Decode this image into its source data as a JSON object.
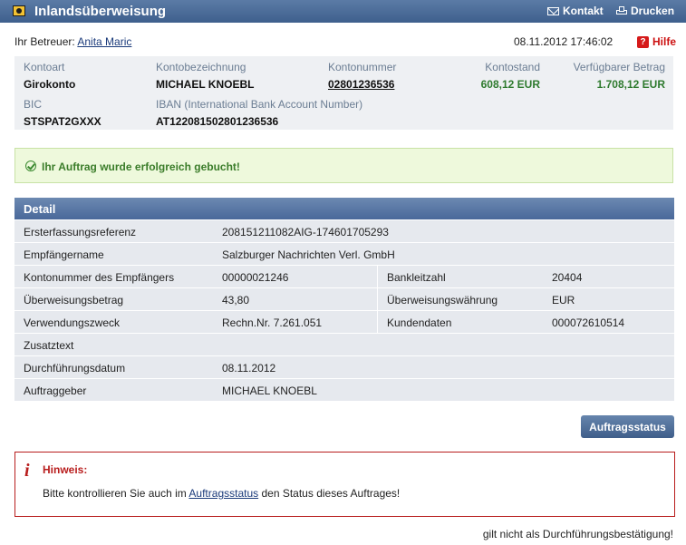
{
  "header": {
    "title": "Inlandsüberweisung",
    "kontakt_label": "Kontakt",
    "drucken_label": "Drucken"
  },
  "betreuer": {
    "label": "Ihr Betreuer:",
    "name": "Anita Maric"
  },
  "datetime": "08.11.2012 17:46:02",
  "hilfe_label": "Hilfe",
  "account": {
    "kontoart_label": "Kontoart",
    "kontoart": "Girokonto",
    "kontobezeichnung_label": "Kontobezeichnung",
    "kontobezeichnung": "MICHAEL KNOEBL",
    "kontonummer_label": "Kontonummer",
    "kontonummer": "02801236536",
    "kontostand_label": "Kontostand",
    "kontostand": "608,12 EUR",
    "verfuegbar_label": "Verfügbarer Betrag",
    "verfuegbar": "1.708,12 EUR",
    "bic_label": "BIC",
    "bic": "STSPAT2GXXX",
    "iban_label": "IBAN (International Bank Account Number)",
    "iban": "AT122081502801236536"
  },
  "success_message": "Ihr Auftrag wurde erfolgreich gebucht!",
  "detail": {
    "title": "Detail",
    "ersterfassung_label": "Ersterfassungsreferenz",
    "ersterfassung": "208151211082AIG-174601705293",
    "empfaengername_label": "Empfängername",
    "empfaengername": "Salzburger Nachrichten Verl. GmbH",
    "kontonummer_empf_label": "Kontonummer des Empfängers",
    "kontonummer_empf": "00000021246",
    "bankleitzahl_label": "Bankleitzahl",
    "bankleitzahl": "20404",
    "betrag_label": "Überweisungsbetrag",
    "betrag": "43,80",
    "waehrung_label": "Überweisungswährung",
    "waehrung": "EUR",
    "verwendungszweck_label": "Verwendungszweck",
    "verwendungszweck": "Rechn.Nr. 7.261.051",
    "kundendaten_label": "Kundendaten",
    "kundendaten": "000072610514",
    "zusatztext_label": "Zusatztext",
    "zusatztext": "",
    "durchfuehrung_label": "Durchführungsdatum",
    "durchfuehrung": "08.11.2012",
    "auftraggeber_label": "Auftraggeber",
    "auftraggeber": "MICHAEL KNOEBL"
  },
  "auftragsstatus_button": "Auftragsstatus",
  "hinweis": {
    "title": "Hinweis:",
    "text_before": "Bitte kontrollieren Sie auch im",
    "link": "Auftragsstatus",
    "text_after": "den Status dieses Auftrages!"
  },
  "footer_note": "gilt nicht als Durchführungsbestätigung!",
  "colors": {
    "header_blue": "#4a6b98",
    "success_green": "#3b7d2a",
    "alert_red": "#b81d1d"
  }
}
